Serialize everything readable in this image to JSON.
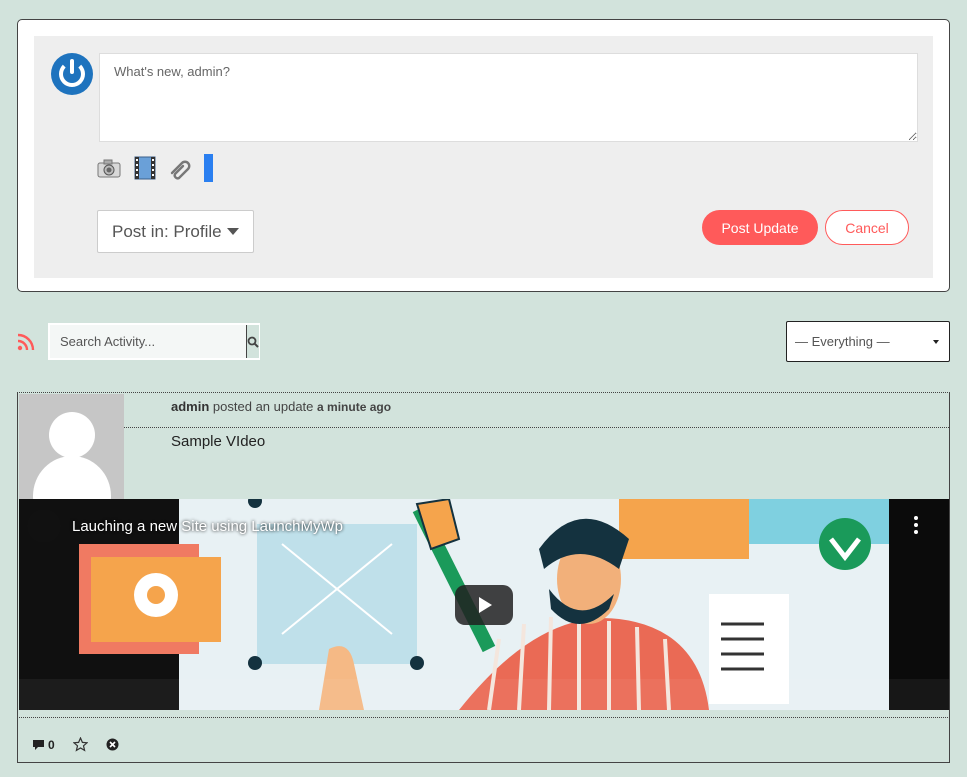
{
  "post_form": {
    "placeholder": "What's new, admin?",
    "media_icons": [
      "camera-icon",
      "film-icon",
      "attachment-icon"
    ],
    "post_in_label": "Post in: Profile",
    "post_button": "Post Update",
    "cancel_button": "Cancel"
  },
  "filters": {
    "search_placeholder": "Search Activity...",
    "filter_value": "— Everything —"
  },
  "activity": {
    "user": "admin",
    "action": "posted an update",
    "time": "a minute ago",
    "text": "Sample VIdeo",
    "video_title": "Lauching a new Site using LaunchMyWp",
    "comment_count": "0"
  },
  "colors": {
    "background": "#d2e3dc",
    "accent": "#ff5a5a",
    "brand_blue": "#1e73be"
  }
}
